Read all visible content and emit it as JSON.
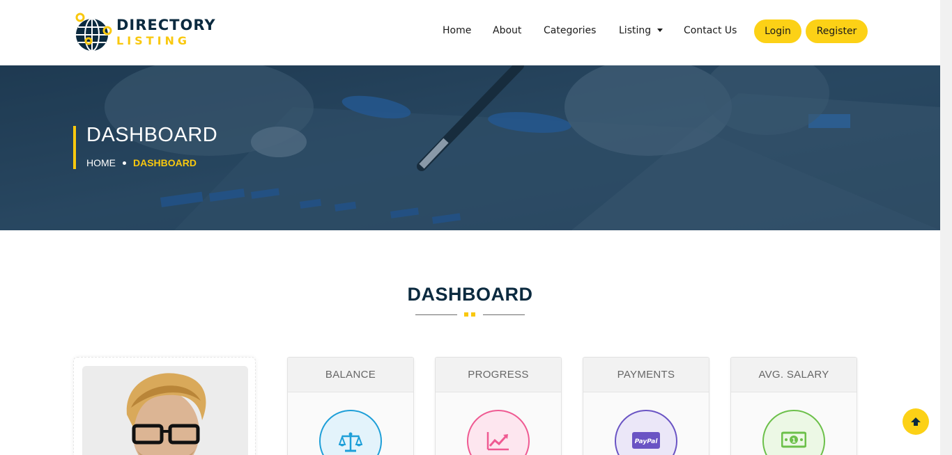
{
  "brand": {
    "name_line1": "DIRECTORY",
    "name_line2": "LISTING",
    "accent_color": "#f9c80e",
    "dark_color": "#0b2a3f"
  },
  "nav": {
    "items": [
      {
        "label": "Home"
      },
      {
        "label": "About"
      },
      {
        "label": "Categories"
      },
      {
        "label": "Listing",
        "has_dropdown": true
      },
      {
        "label": "Contact Us"
      }
    ],
    "login_label": "Login",
    "register_label": "Register"
  },
  "banner": {
    "title": "DASHBOARD",
    "breadcrumb": {
      "home": "HOME",
      "current": "DASHBOARD"
    }
  },
  "section": {
    "title": "DASHBOARD"
  },
  "stats": [
    {
      "label": "BALANCE",
      "icon": "balance-scale-icon",
      "color": "#1e9fd8",
      "bg": "#e3f3fb"
    },
    {
      "label": "PROGRESS",
      "icon": "line-chart-icon",
      "color": "#ef5a92",
      "bg": "#fde6ef"
    },
    {
      "label": "PAYMENTS",
      "icon": "paypal-icon",
      "color": "#6a54c4",
      "bg": "#ebe7f8"
    },
    {
      "label": "AVG. SALARY",
      "icon": "money-bill-icon",
      "color": "#6cc04a",
      "bg": "#ecf8e5"
    }
  ],
  "scroll_top_icon": "arrow-up-icon"
}
